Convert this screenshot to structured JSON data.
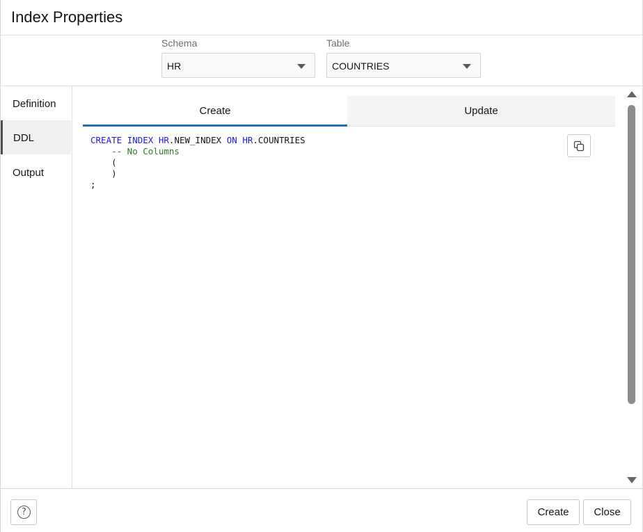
{
  "dialog": {
    "title": "Index Properties"
  },
  "selectors": {
    "schema": {
      "label": "Schema",
      "value": "HR"
    },
    "table": {
      "label": "Table",
      "value": "COUNTRIES"
    }
  },
  "sidenav": {
    "items": [
      {
        "label": "Definition",
        "active": false
      },
      {
        "label": "DDL",
        "active": true
      },
      {
        "label": "Output",
        "active": false
      }
    ]
  },
  "tabs": [
    {
      "label": "Create",
      "active": true
    },
    {
      "label": "Update",
      "active": false
    }
  ],
  "ddl": {
    "line1": {
      "kw1": "CREATE",
      "kw2": "INDEX",
      "schema1": "HR",
      "idx": ".NEW_INDEX",
      "kw3": "ON",
      "schema2": "HR",
      "tbl": ".COUNTRIES"
    },
    "line2": "    -- No Columns",
    "line3": "    (",
    "line4": "    )",
    "line5": ";"
  },
  "footer": {
    "help_label": "?",
    "create_label": "Create",
    "close_label": "Close"
  },
  "colors": {
    "keyword": "#1a1ae6",
    "comment": "#2a7a2a",
    "active_tab_accent": "#1f6fb5"
  },
  "icons": {
    "copy": "copy-icon",
    "help": "help-icon",
    "dropdown": "chevron-down-icon"
  }
}
